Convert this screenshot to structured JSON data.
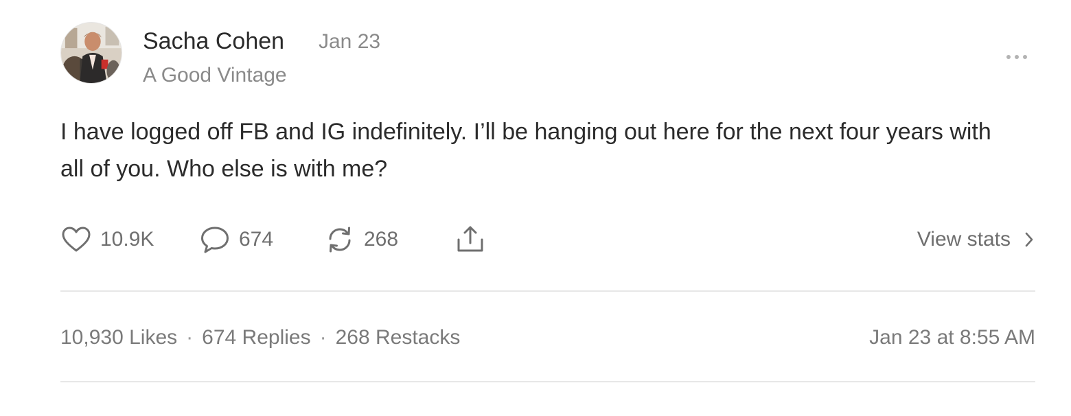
{
  "author": {
    "name": "Sacha Cohen",
    "publication": "A Good Vintage",
    "avatar_icon": "profile-photo"
  },
  "post": {
    "date": "Jan 23",
    "body": "I have logged off FB and IG indefinitely. I’ll be hanging out here for the next four years with all of you. Who else is with me?",
    "more_icon": "ellipsis-icon"
  },
  "actions": {
    "likes": "10.9K",
    "replies": "674",
    "restacks": "268",
    "view_stats": "View stats"
  },
  "stats": {
    "likes": "10,930 Likes",
    "replies": "674 Replies",
    "restacks": "268 Restacks",
    "separator": "·",
    "timestamp": "Jan 23 at 8:55 AM"
  },
  "colors": {
    "text": "#2b2b2b",
    "muted": "#8a8a8a",
    "divider": "#e7e7e7"
  }
}
